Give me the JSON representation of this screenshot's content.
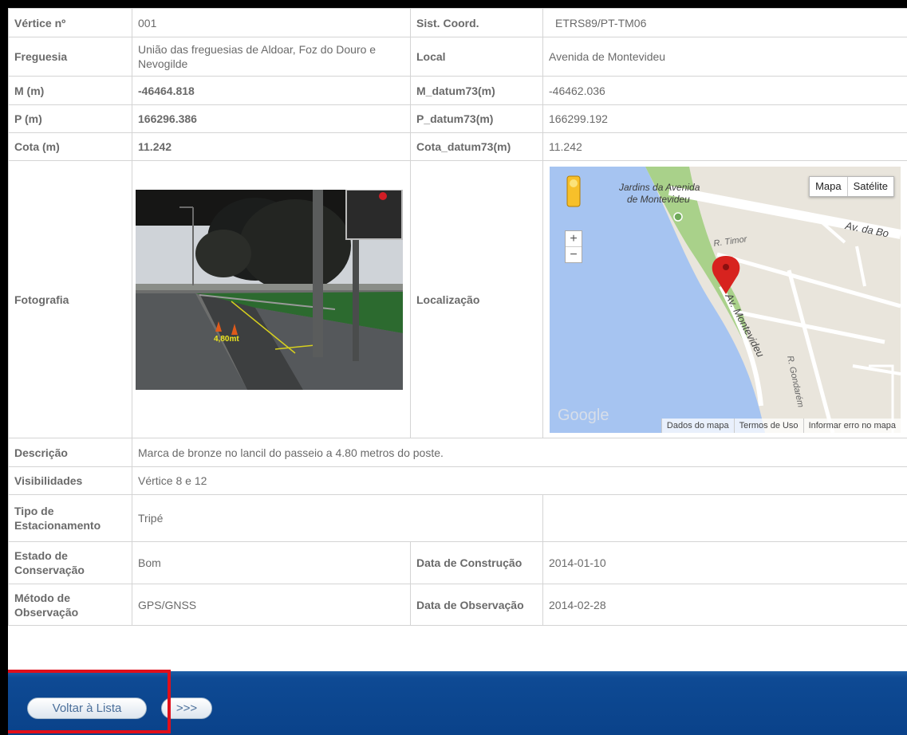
{
  "rows": {
    "vertice": {
      "label": "Vértice nº",
      "value": "001",
      "label2": "Sist. Coord.",
      "value2": "ETRS89/PT-TM06"
    },
    "freguesia": {
      "label": "Freguesia",
      "value": "União das freguesias de Aldoar, Foz do Douro e Nevogilde",
      "label2": "Local",
      "value2": "Avenida de Montevideu"
    },
    "m": {
      "label": "M (m)",
      "value": "-46464.818",
      "label2": "M_datum73(m)",
      "value2": "-46462.036"
    },
    "p": {
      "label": "P (m)",
      "value": "166296.386",
      "label2": "P_datum73(m)",
      "value2": "166299.192"
    },
    "cota": {
      "label": "Cota (m)",
      "value": "11.242",
      "label2": "Cota_datum73(m)",
      "value2": "11.242"
    },
    "fotografia": {
      "label": "Fotografia",
      "label2": "Localização",
      "photo_annotation": "4,80mt"
    },
    "descricao": {
      "label": "Descrição",
      "value": "Marca de bronze no lancil do passeio a 4.80 metros do poste."
    },
    "visibilidades": {
      "label": "Visibilidades",
      "value": "Vértice 8 e 12"
    },
    "tipo": {
      "label": "Tipo de Estacionamento",
      "value": "Tripé"
    },
    "estado": {
      "label": "Estado de Conservação",
      "value": "Bom",
      "label2": "Data de Construção",
      "value2": "2014-01-10"
    },
    "metodo": {
      "label": "Método de Observação",
      "value": "GPS/GNSS",
      "label2": "Data de Observação",
      "value2": "2014-02-28"
    }
  },
  "map": {
    "type_map": "Mapa",
    "type_satellite": "Satélite",
    "zoom_in": "+",
    "zoom_out": "−",
    "park_label_line1": "Jardins da Avenida",
    "park_label_line2": "de Montevideu",
    "street_av_boa": "Av. da Bo",
    "street_timor": "R. Timor",
    "street_montevideu": "Av. Montevideu",
    "street_gondarem": "R. Gondarém",
    "logo": "Google",
    "footer_data": "Dados do mapa",
    "footer_terms": "Termos de Uso",
    "footer_report": "Informar erro no mapa"
  },
  "footer": {
    "back_button": "Voltar à Lista",
    "next_button": ">>>"
  },
  "colors": {
    "label_blue": "#0b2f7a",
    "label_green": "#1f6b1f",
    "value_blue": "#1d2fa0",
    "footer_bar": "#0e4a94",
    "highlight_red": "#e10f1a"
  }
}
